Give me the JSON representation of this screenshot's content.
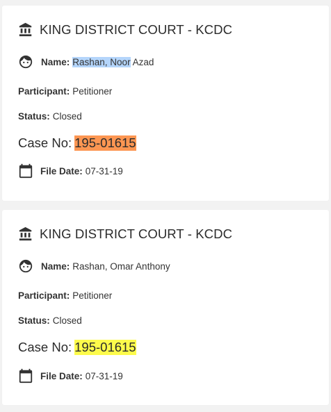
{
  "records": [
    {
      "court": "KING DISTRICT COURT - KCDC",
      "name_label": "Name:",
      "name_highlighted": "Rashan, Noor",
      "name_rest": " Azad",
      "participant_label": "Participant:",
      "participant": "Petitioner",
      "status_label": "Status:",
      "status": "Closed",
      "case_label": "Case No:",
      "case_no": "195-01615",
      "file_date_label": "File Date:",
      "file_date": "07-31-19",
      "case_highlight_color": "#fd9652"
    },
    {
      "court": "KING DISTRICT COURT - KCDC",
      "name_label": "Name:",
      "name": "Rashan, Omar Anthony",
      "participant_label": "Participant:",
      "participant": "Petitioner",
      "status_label": "Status:",
      "status": "Closed",
      "case_label": "Case No:",
      "case_no": "195-01615",
      "file_date_label": "File Date:",
      "file_date": "07-31-19",
      "case_highlight_color": "#fdfb4b"
    }
  ],
  "icons": {
    "court": "courthouse-icon",
    "name": "face-icon",
    "file_date": "calendar-icon"
  },
  "colors": {
    "selection_highlight": "#b4d5fb"
  }
}
